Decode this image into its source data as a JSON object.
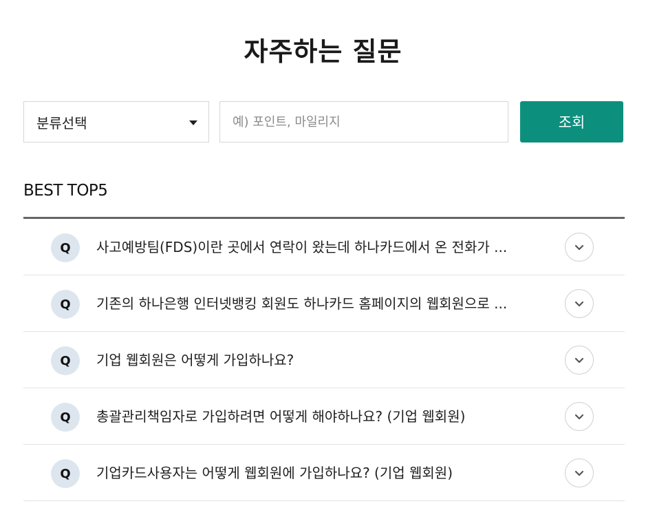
{
  "page": {
    "title": "자주하는 질문"
  },
  "search": {
    "category_selected": "분류선택",
    "keyword_placeholder": "예) 포인트, 마일리지",
    "keyword_value": "",
    "submit_label": "조회"
  },
  "best": {
    "title": "BEST TOP5",
    "q_marker": "Q",
    "items": [
      {
        "question": "사고예방팀(FDS)이란 곳에서 연락이 왔는데 하나카드에서 온 전화가 ..."
      },
      {
        "question": "기존의 하나은행 인터넷뱅킹 회원도 하나카드 홈페이지의 웹회원으로 ..."
      },
      {
        "question": "기업 웹회원은 어떻게 가입하나요?"
      },
      {
        "question": "총괄관리책임자로 가입하려면 어떻게 해야하나요? (기업 웹회원)"
      },
      {
        "question": "기업카드사용자는 어떻게 웹회원에 가입하나요? (기업 웹회원)"
      }
    ]
  },
  "icons": {
    "select_caret": "caret-down-icon",
    "expand": "chevron-down-icon"
  },
  "colors": {
    "accent": "#0d8f7e",
    "q_badge_bg": "#dde6ee",
    "list_top_border": "#666666"
  }
}
